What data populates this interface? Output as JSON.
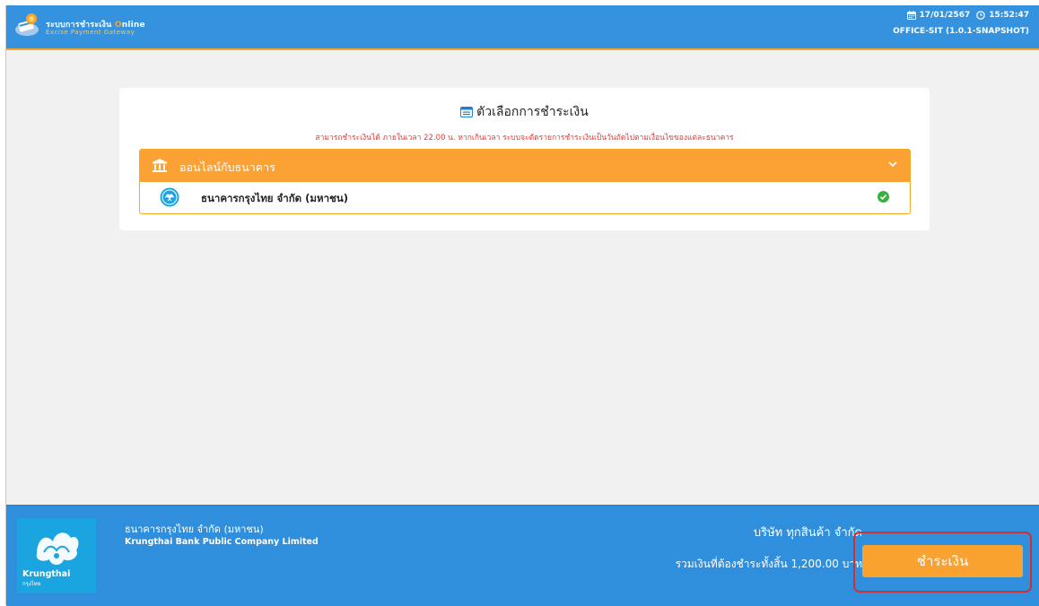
{
  "header": {
    "app_name_prefix": "ระบบการชำระเงิน ",
    "app_name_online_o": "O",
    "app_name_online_rest": "nline",
    "app_subtitle": "Excise Payment Gateway",
    "date": "17/01/2567",
    "time": "15:52:47",
    "environment": "OFFICE-SIT (1.0.1-SNAPSHOT)"
  },
  "payment_options": {
    "title": "ตัวเลือกการชำระเงิน",
    "notice": "สามารถชำระเงินได้ ภายในเวลา 22.00 น. หากเกินเวลา ระบบจะตัดรายการชำระเงินเป็นวันถัดไปตามเงื่อนไขของแต่ละธนาคาร",
    "group_label": "ออนไลน์กับธนาคาร",
    "banks": [
      {
        "name": "ธนาคารกรุงไทย จำกัด (มหาชน)",
        "selected": true
      }
    ]
  },
  "footer": {
    "bank_name_th": "ธนาคารกรุงไทย จำกัด (มหาชน)",
    "bank_name_en": "Krungthai Bank Public Company Limited",
    "logo_text": "Krungthai",
    "logo_subtext": "กรุงไทย",
    "company": "บริษัท ทุกสินค้า จำกัด",
    "total_text": "รวมเงินที่ต้องชำระทั้งสิ้น 1,200.00 บาท",
    "pay_button_label": "ชำระเงิน"
  },
  "colors": {
    "header_blue": "#3592de",
    "accent_orange": "#fca235",
    "footer_blue": "#2f8fdc",
    "ktb_blue": "#1ba5e0",
    "notice_red": "#e53935",
    "check_green": "#3cb043",
    "highlight_red": "#d32f2f"
  },
  "icons": {
    "header_logo": "payment-logo-icon",
    "date": "calendar-icon",
    "time": "clock-icon",
    "title": "list-icon",
    "group": "bank-building-icon",
    "expand": "chevron-down-icon",
    "bank_logo": "krungthai-logo-icon",
    "selected": "check-circle-icon"
  }
}
